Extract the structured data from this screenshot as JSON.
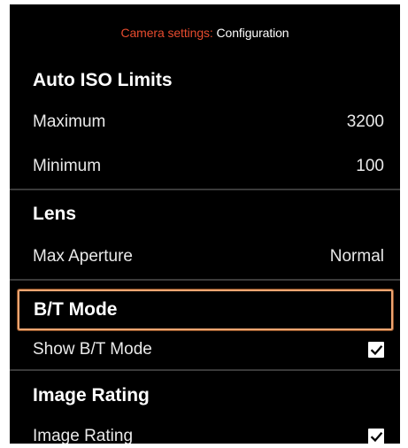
{
  "header": {
    "breadcrumb": "Camera settings:",
    "title": "Configuration"
  },
  "sections": [
    {
      "title": "Auto ISO Limits",
      "rows": [
        {
          "label": "Maximum",
          "value": "3200"
        },
        {
          "label": "Minimum",
          "value": "100"
        }
      ]
    },
    {
      "title": "Lens",
      "rows": [
        {
          "label": "Max Aperture",
          "value": "Normal"
        }
      ]
    },
    {
      "title": "B/T Mode",
      "rows": [
        {
          "label": "Show B/T Mode",
          "checked": true
        }
      ]
    },
    {
      "title": "Image Rating",
      "rows": [
        {
          "label": "Image Rating",
          "checked": true
        }
      ]
    }
  ],
  "colors": {
    "background": "#000000",
    "breadcrumb": "#e64b2e",
    "focus_border": "#f0a571",
    "divider": "#3a3a3a"
  },
  "icons": {
    "checkbox": "checkmark-icon"
  }
}
